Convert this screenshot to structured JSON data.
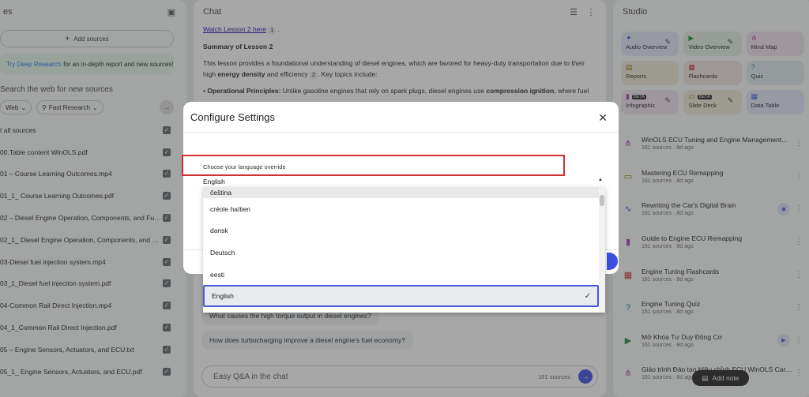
{
  "left": {
    "title": "es",
    "add_sources": "Add sources",
    "deep_research_link": "Try Deep Research",
    "deep_research_text": "for an in-depth report and new sources!",
    "search_web": "Search the web for new sources",
    "chip_web": "Web",
    "chip_research": "Fast Research",
    "select_all": "t all sources",
    "sources": [
      "00.Table content WinOLS.pdf",
      "01 – Course Learning Outcomes.mp4",
      "01_1_ Course Learning Outcomes.pdf",
      "02 – Diesel Engine Operation, Components, and Fun...",
      "02_1_ Diesel Engine Operation, Components, and Fu...",
      "03-Diesel fuel injection system.mp4",
      "03_1_Diesel fuel injection system.pdf",
      "04-Common Rail Direct Injection.mp4",
      "04_1_Common Rail Direct Injection.pdf",
      "05 – Engine Sensors, Actuators, and ECU.txt",
      "05_1_ Engine Sensors, Actuators, and ECU.pdf"
    ]
  },
  "chat": {
    "title": "Chat",
    "watch_link": "Watch Lesson 2 here",
    "watch_ref": "1",
    "summary_heading": "Summary of Lesson 2",
    "summary_pre": "This lesson provides a foundational understanding of diesel engines, which are favored for heavy-duty transportation due to their high",
    "summary_bold1": "energy density",
    "summary_mid": "and efficiency",
    "summary_ref": "2",
    "summary_post": ". Key topics include:",
    "bullet_label": "Operational Principles:",
    "bullet_text": "Unlike gasoline engines that rely on spark plugs, diesel engines use",
    "bullet_bold": "compression ignition",
    "bullet_tail": ", where fuel",
    "question1": "What causes the high torque output in diesel engines?",
    "question2": "How does turbocharging improve a diesel engine's fuel economy?",
    "input_placeholder": "Easy Q&A in the chat",
    "source_count": "161 sources"
  },
  "studio": {
    "title": "Studio",
    "tiles": [
      {
        "label": "Audio Overview",
        "beta": ""
      },
      {
        "label": "Video Overview",
        "beta": ""
      },
      {
        "label": "Mind Map",
        "beta": ""
      },
      {
        "label": "Reports",
        "beta": ""
      },
      {
        "label": "Flashcards",
        "beta": ""
      },
      {
        "label": "Quiz",
        "beta": ""
      },
      {
        "label": "Infographic",
        "beta": "BETA"
      },
      {
        "label": "Slide Deck",
        "beta": "BETA"
      },
      {
        "label": "Data Table",
        "beta": ""
      }
    ],
    "notes": [
      {
        "title": "WinOLS ECU Tuning and Engine Management...",
        "meta": "161 sources · 8d ago"
      },
      {
        "title": "Mastering ECU Remapping",
        "meta": "161 sources · 8d ago"
      },
      {
        "title": "Rewriting the Car's Digital Brain",
        "meta": "161 sources · 8d ago"
      },
      {
        "title": "Guide to Engine ECU Remapping",
        "meta": "161 sources · 8d ago"
      },
      {
        "title": "Engine Tuning Flashcards",
        "meta": "161 sources · 8d ago"
      },
      {
        "title": "Engine Tuning Quiz",
        "meta": "161 sources · 8d ago"
      },
      {
        "title": "Mở Khóa Tư Duy Động Cơ",
        "meta": "161 sources · 8d ago"
      },
      {
        "title": "Giáo trình Đào tạo Hiệu chỉnh ECU WinOLS Carac...",
        "meta": "161 sources · 8d ago"
      }
    ],
    "add_note": "Add note"
  },
  "dialog": {
    "title": "Configure Settings",
    "language_label": "Choose your language override",
    "selected_value": "English",
    "options": [
      "čeština",
      "créole haïtien",
      "dansk",
      "Deutsch",
      "eesti",
      "English"
    ]
  }
}
